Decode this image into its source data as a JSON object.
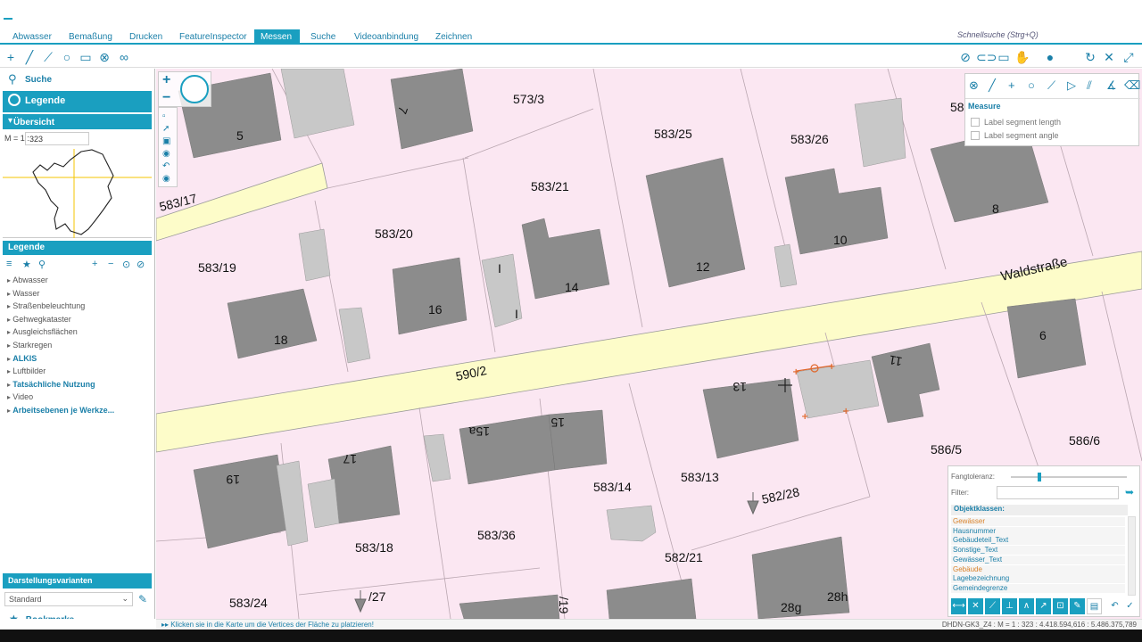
{
  "menu": {
    "tabs": [
      "Abwasser",
      "Bemaßung",
      "Drucken",
      "FeatureInspector",
      "Messen",
      "Suche",
      "Videoanbindung",
      "Zeichnen"
    ],
    "active": "Messen",
    "quicksearch": "Schnellsuche (Strg+Q)"
  },
  "left": {
    "search": "Suche",
    "legend_title": "Legende",
    "uebersicht": "Übersicht",
    "scale_label": "M = 1 :",
    "scale_value": "323",
    "legende_header": "Legende",
    "legend_items": [
      {
        "label": "Abwasser",
        "bold": false
      },
      {
        "label": "Wasser",
        "bold": false
      },
      {
        "label": "Straßenbeleuchtung",
        "bold": false
      },
      {
        "label": "Gehwegkataster",
        "bold": false
      },
      {
        "label": "Ausgleichsflächen",
        "bold": false
      },
      {
        "label": "Starkregen",
        "bold": false
      },
      {
        "label": "ALKIS",
        "bold": true
      },
      {
        "label": "Luftbilder",
        "bold": false
      },
      {
        "label": "Tatsächliche Nutzung",
        "bold": true
      },
      {
        "label": "Video",
        "bold": false
      },
      {
        "label": "Arbeitsebenen je Werkze...",
        "bold": true
      }
    ],
    "darstellung_header": "Darstellungsvarianten",
    "darstellung_value": "Standard",
    "bookmarks": "Bookmarks"
  },
  "measure": {
    "title": "Measure",
    "options": [
      "Label segment length",
      "Label segment angle"
    ]
  },
  "snap": {
    "tolerance_label": "Fangtoleranz:",
    "filter_label": "Filter:",
    "objektklassen_label": "Objektklassen:",
    "items": [
      {
        "label": "Gewässer",
        "orange": true
      },
      {
        "label": "Hausnummer",
        "orange": false
      },
      {
        "label": "Gebäudeteil_Text",
        "orange": false
      },
      {
        "label": "Sonstige_Text",
        "orange": false
      },
      {
        "label": "Gewässer_Text",
        "orange": false
      },
      {
        "label": "Gebäude",
        "orange": true
      },
      {
        "label": "Lagebezeichnung",
        "orange": false
      },
      {
        "label": "Gemeindegrenze",
        "orange": false
      }
    ]
  },
  "map": {
    "parcels": [
      "573/3",
      "583/25",
      "583/26",
      "58",
      "583/21",
      "583/17",
      "583/20",
      "583/19",
      "590/2",
      "582/28",
      "583/13",
      "583/14",
      "583/36",
      "583/18",
      "582/21",
      "583/24",
      "586/5",
      "586/6",
      "/27",
      "/19"
    ],
    "house_numbers": [
      "5",
      "7",
      "8",
      "10",
      "12",
      "14",
      "16",
      "18",
      "6",
      "11",
      "13",
      "15",
      "15a",
      "17",
      "19",
      "28g",
      "28h",
      "I",
      "I"
    ],
    "street": "Waldstraße"
  },
  "status": {
    "hint": "Klicken sie in die Karte um die Vertices der Fläche zu platzieren!",
    "info": "DHDN-GK3_Z4 : M = 1 : 323 : 4.418.594,616 : 5.486.375,789"
  }
}
